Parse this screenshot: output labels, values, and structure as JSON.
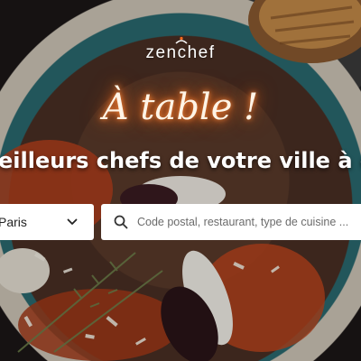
{
  "brand": {
    "name": "zenchef",
    "logo_icon": "chef-hat-icon"
  },
  "hero": {
    "headline": "À table !",
    "tagline": "eilleurs chefs de votre ville à emp"
  },
  "search_bar": {
    "city_value": "Paris",
    "city_icon": "chevron-down-icon",
    "search_icon": "search-icon",
    "placeholder": "Code postal, restaurant, type de cuisine ..."
  },
  "colors": {
    "headline_glow": "#ff6a1a",
    "text": "#ffffff",
    "field_bg": "#ffffff"
  }
}
